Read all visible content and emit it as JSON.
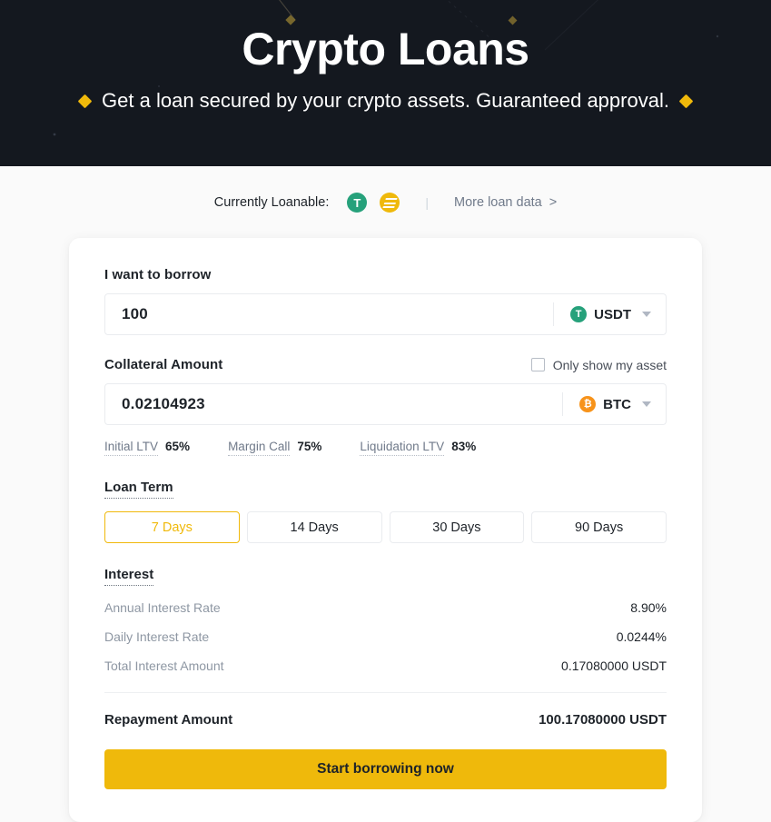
{
  "hero": {
    "title": "Crypto Loans",
    "subtitle": "Get a loan secured by your crypto assets. Guaranteed approval.",
    "bg_color": "#14181f",
    "accent_color": "#f0b90b"
  },
  "loanable": {
    "label": "Currently Loanable:",
    "coins": [
      {
        "symbol": "USDT",
        "glyph": "T",
        "color": "#26a17b"
      },
      {
        "symbol": "FDUSD",
        "glyph": "",
        "color": "#efb90b"
      }
    ],
    "separator": "|",
    "more_link": "More loan data",
    "more_chevron": ">"
  },
  "borrow": {
    "label": "I want to borrow",
    "amount": "100",
    "placeholder": "Please enter amount",
    "asset": "USDT",
    "asset_glyph": "T",
    "asset_color": "#26a17b"
  },
  "collateral": {
    "label": "Collateral Amount",
    "checkbox_label": "Only show my asset",
    "checkbox_checked": false,
    "amount": "0.02104923",
    "placeholder": "Please enter amount",
    "asset": "BTC",
    "asset_glyph": "₿",
    "asset_color": "#f7931a"
  },
  "ltv": [
    {
      "label": "Initial LTV",
      "value": "65%"
    },
    {
      "label": "Margin Call",
      "value": "75%"
    },
    {
      "label": "Liquidation LTV",
      "value": "83%"
    }
  ],
  "loan_term": {
    "title": "Loan Term",
    "options": [
      {
        "label": "7 Days",
        "selected": true
      },
      {
        "label": "14 Days",
        "selected": false
      },
      {
        "label": "30 Days",
        "selected": false
      },
      {
        "label": "90 Days",
        "selected": false
      }
    ]
  },
  "interest": {
    "title": "Interest",
    "rows": [
      {
        "key": "Annual Interest Rate",
        "value": "8.90%"
      },
      {
        "key": "Daily Interest Rate",
        "value": "0.0244%"
      },
      {
        "key": "Total Interest Amount",
        "value": "0.17080000 USDT"
      }
    ]
  },
  "repayment": {
    "label": "Repayment Amount",
    "value": "100.17080000 USDT"
  },
  "cta": {
    "label": "Start borrowing now",
    "color": "#efb90b"
  }
}
